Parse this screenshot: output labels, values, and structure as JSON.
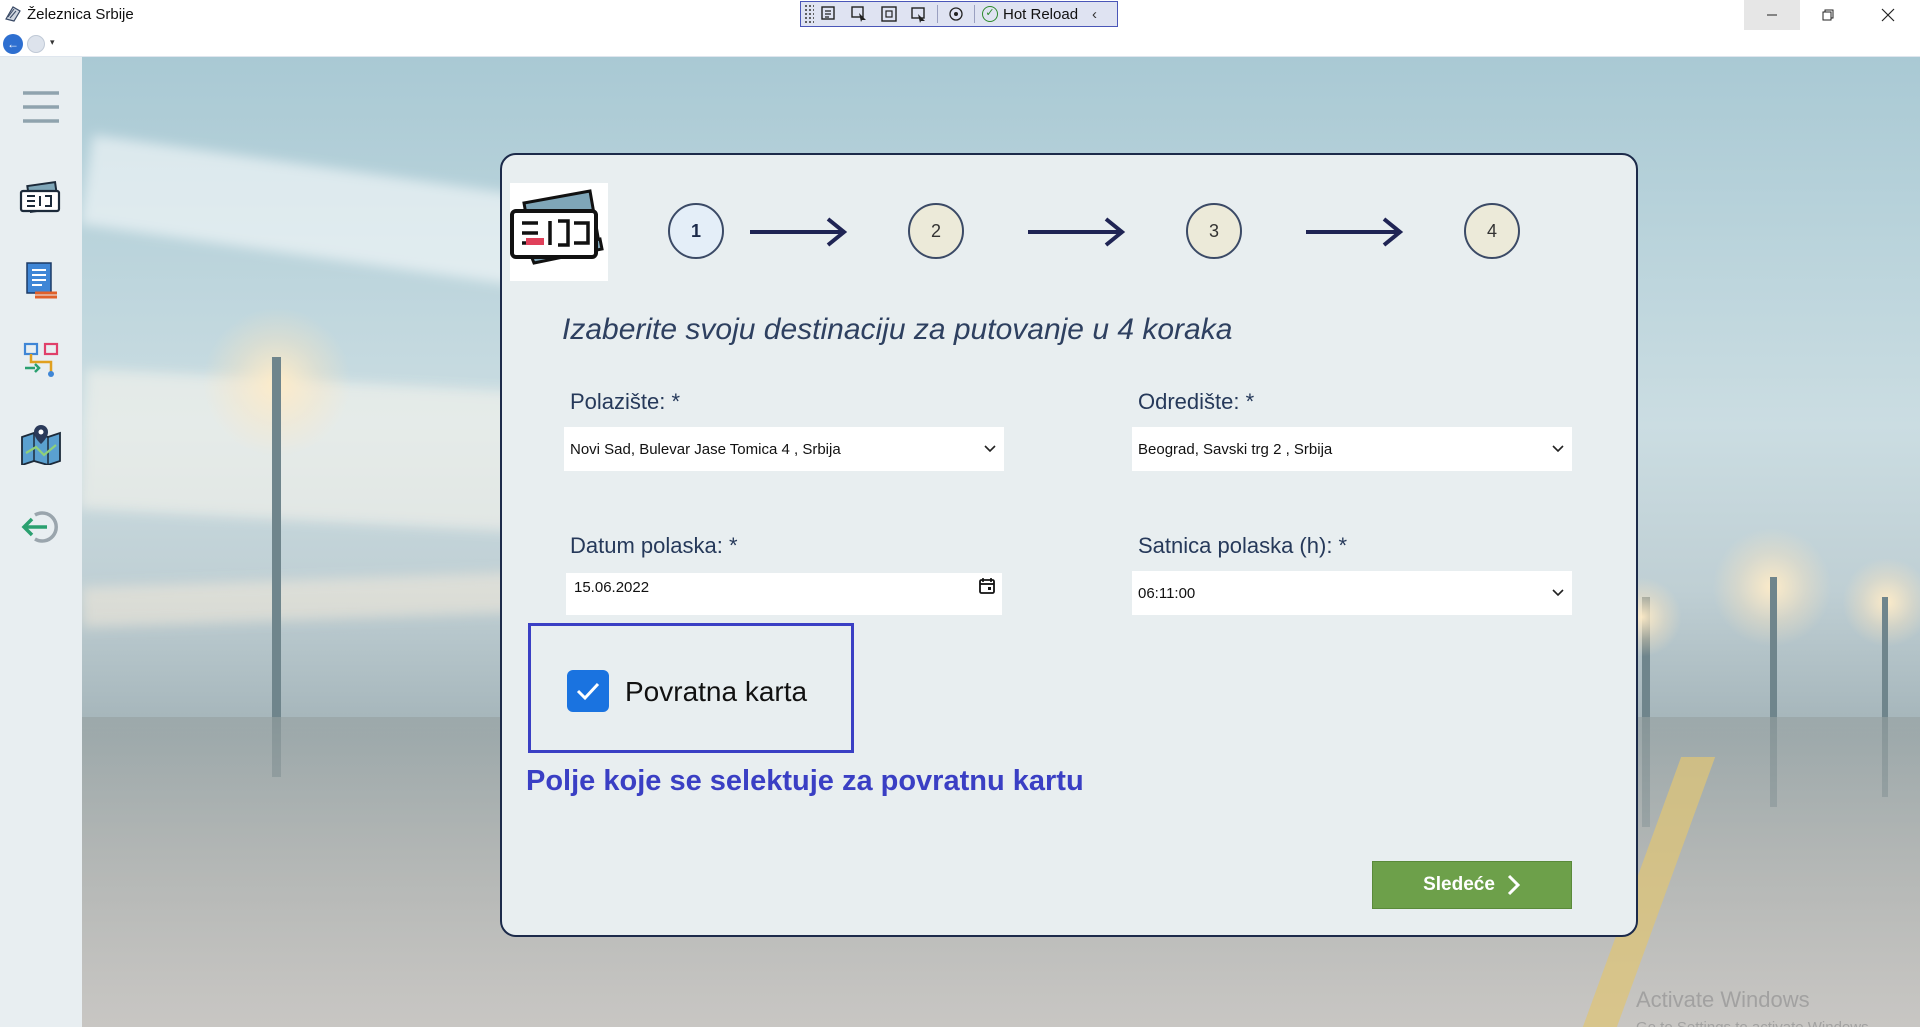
{
  "window": {
    "title": "Železnica Srbije",
    "devtools": {
      "hot_reload_label": "Hot Reload"
    }
  },
  "sidebar": {
    "items": [
      {
        "name": "menu",
        "icon": "hamburger-menu-icon"
      },
      {
        "name": "tickets",
        "icon": "ticket-icon"
      },
      {
        "name": "timetable",
        "icon": "list-document-icon"
      },
      {
        "name": "routes",
        "icon": "route-icon"
      },
      {
        "name": "map",
        "icon": "map-icon"
      },
      {
        "name": "logout",
        "icon": "logout-icon"
      }
    ]
  },
  "wizard": {
    "steps": [
      "1",
      "2",
      "3",
      "4"
    ],
    "active_step": 1,
    "headline": "Izaberite svoju destinaciju za putovanje u 4 koraka",
    "departure_label": "Polazište: *",
    "departure_value": "Novi Sad, Bulevar Jase Tomica 4 , Srbija",
    "destination_label": "Odredište: *",
    "destination_value": "Beograd, Savski trg 2 , Srbija",
    "date_label": "Datum polaska: *",
    "date_value": "15.06.2022",
    "time_label": "Satnica polaska (h): *",
    "time_value": "06:11:00",
    "return_ticket_label": "Povratna karta",
    "return_ticket_checked": true,
    "annotation": "Polje koje se selektuje za povratnu kartu",
    "next_label": "Sledeće"
  },
  "watermark": {
    "line1": "Activate Windows",
    "line2": "Go to Settings to activate Windows."
  },
  "colors": {
    "accent_blue": "#3a3fc4",
    "checkbox_blue": "#1a73e0",
    "next_green": "#6da04a",
    "heading_navy": "#2e4060"
  }
}
